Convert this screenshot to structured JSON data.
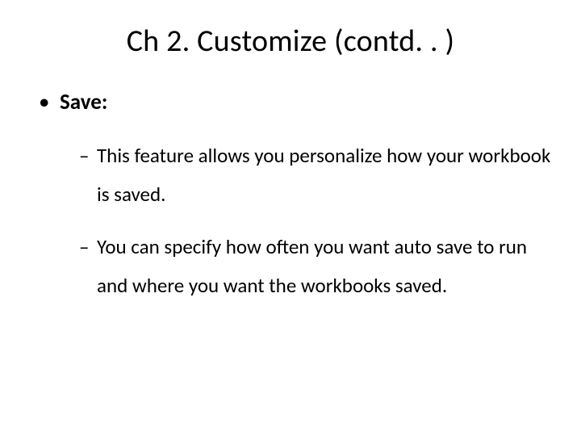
{
  "title": "Ch 2. Customize (contd. . )",
  "bullets": {
    "level1": {
      "label": "Save:"
    },
    "level2": {
      "item1": "This feature allows you personalize how your workbook is saved.",
      "item2": "You can specify how often you want auto save to run and where you want the workbooks saved."
    }
  }
}
